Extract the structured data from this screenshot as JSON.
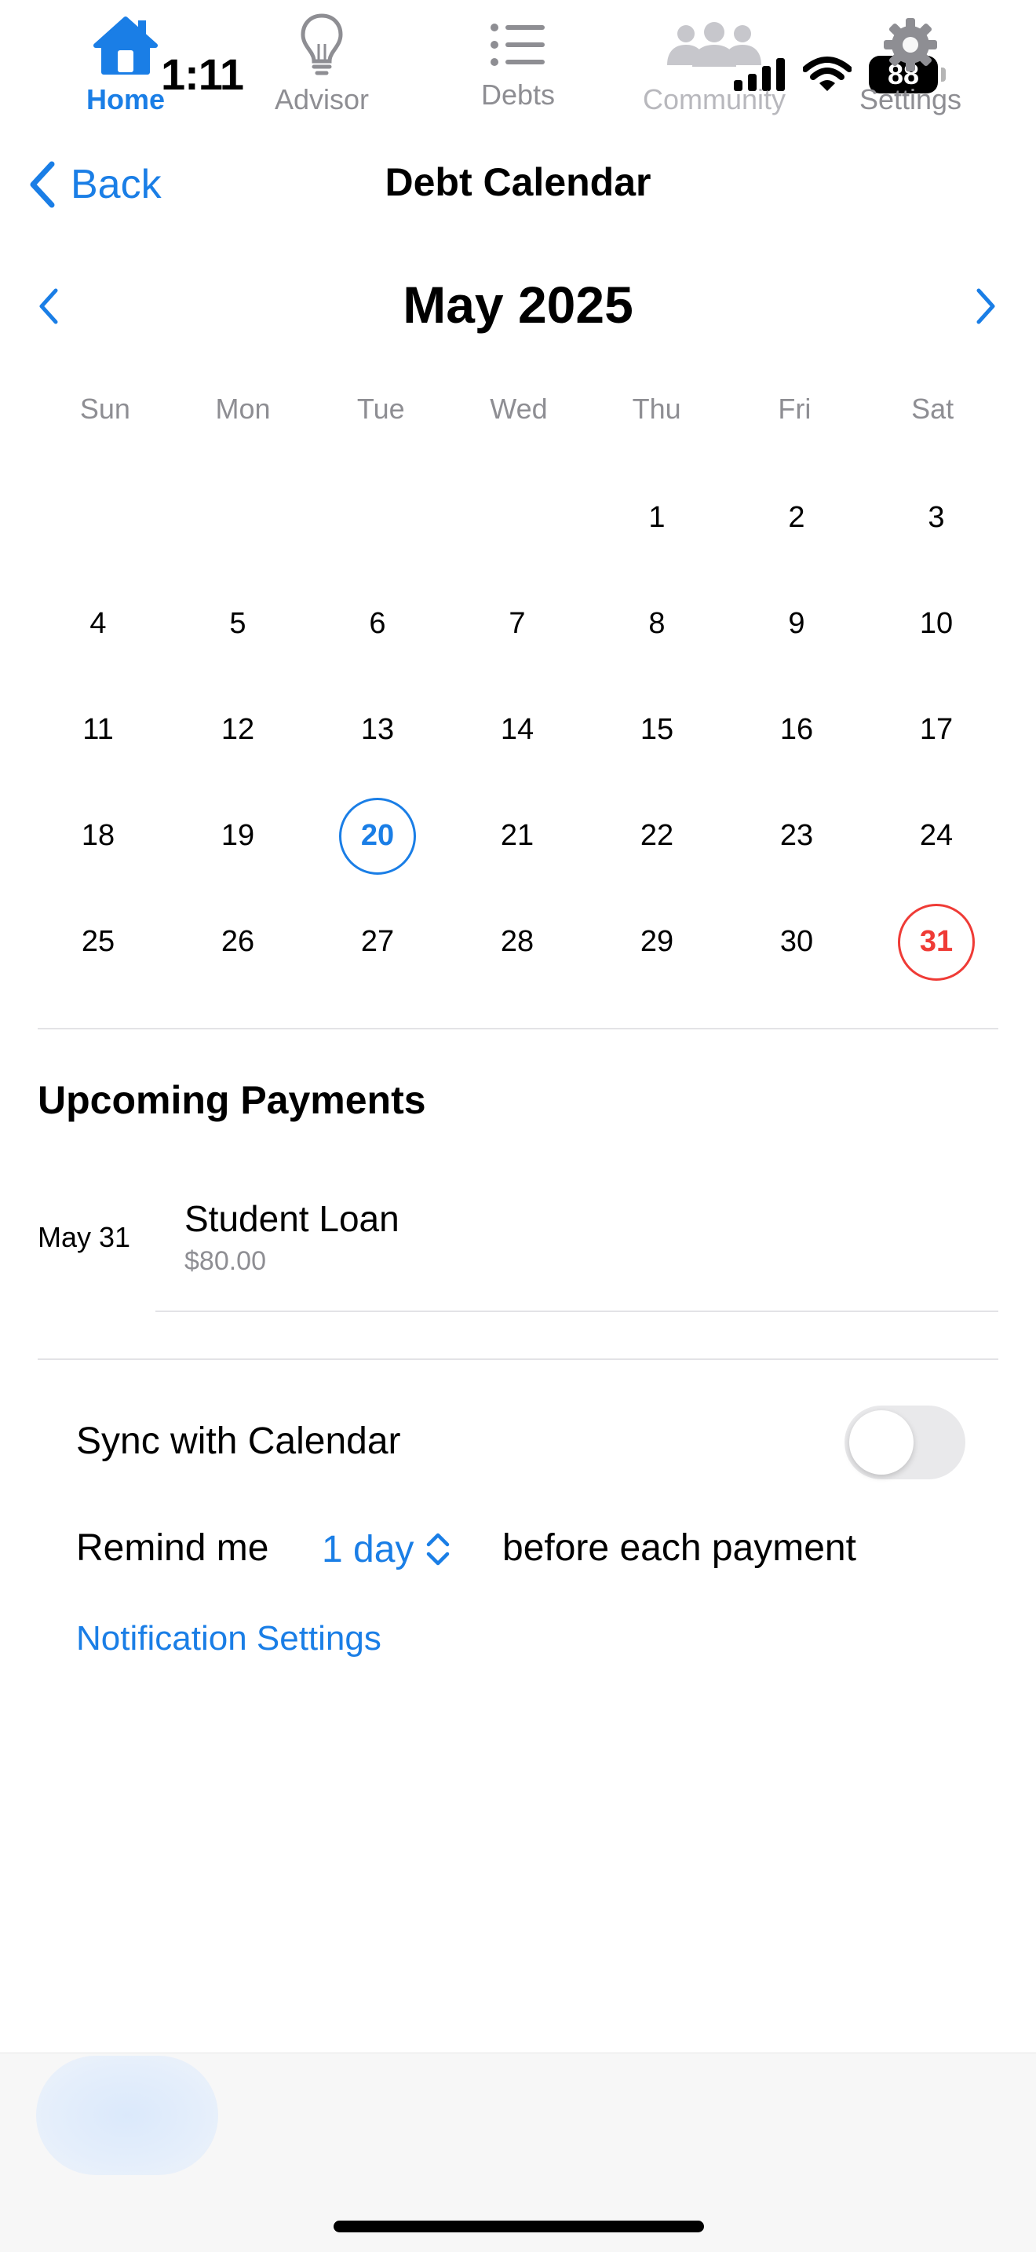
{
  "status_bar": {
    "time": "1:11",
    "battery": "88"
  },
  "nav": {
    "back_label": "Back",
    "title": "Debt Calendar"
  },
  "calendar": {
    "month_title": "May 2025",
    "weekdays": [
      "Sun",
      "Mon",
      "Tue",
      "Wed",
      "Thu",
      "Fri",
      "Sat"
    ],
    "leading_blank_days": 4,
    "days": [
      "1",
      "2",
      "3",
      "4",
      "5",
      "6",
      "7",
      "8",
      "9",
      "10",
      "11",
      "12",
      "13",
      "14",
      "15",
      "16",
      "17",
      "18",
      "19",
      "20",
      "21",
      "22",
      "23",
      "24",
      "25",
      "26",
      "27",
      "28",
      "29",
      "30",
      "31"
    ],
    "today": "20",
    "due_days": [
      "31"
    ]
  },
  "upcoming": {
    "title": "Upcoming Payments",
    "payments": [
      {
        "date": "May 31",
        "name": "Student Loan",
        "amount": "$80.00"
      }
    ]
  },
  "settings": {
    "sync_label": "Sync with Calendar",
    "sync_enabled": false,
    "remind_label": "Remind me",
    "remind_value": "1 day",
    "remind_suffix": "before each payment",
    "notification_link": "Notification Settings"
  },
  "tabs": [
    {
      "label": "Home",
      "icon": "house-icon",
      "active": true
    },
    {
      "label": "Advisor",
      "icon": "lightbulb-icon",
      "active": false
    },
    {
      "label": "Debts",
      "icon": "list-icon",
      "active": false
    },
    {
      "label": "Community",
      "icon": "people-icon",
      "active": false
    },
    {
      "label": "Settings",
      "icon": "gear-icon",
      "active": false
    }
  ],
  "colors": {
    "accent": "#1a7ee6",
    "due": "#ef3b36",
    "secondary_text": "#8e8e93"
  }
}
